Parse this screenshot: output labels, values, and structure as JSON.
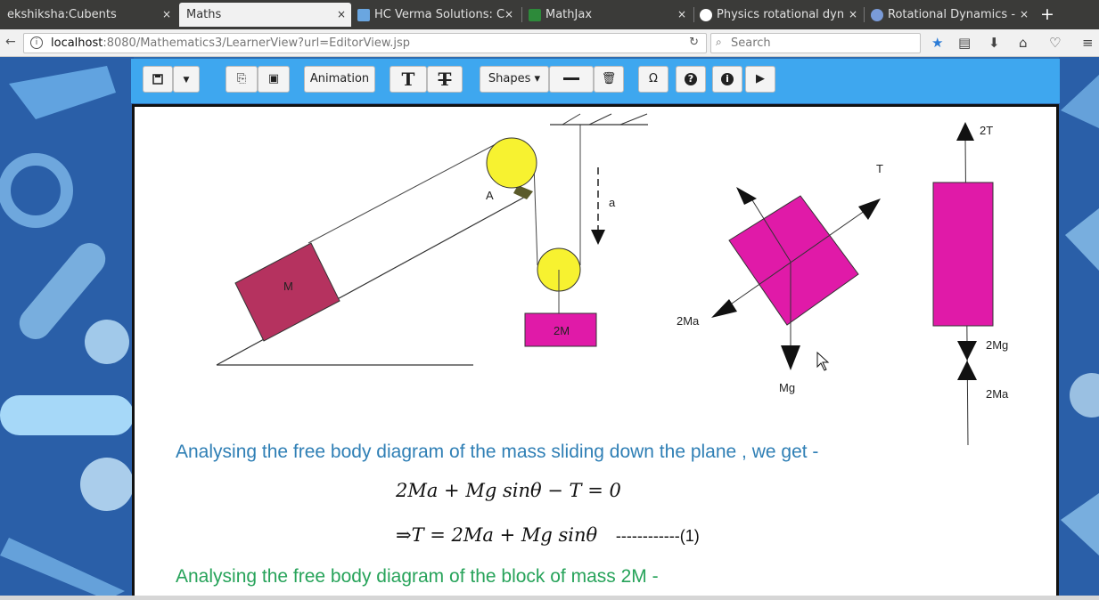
{
  "browser": {
    "tabs": [
      {
        "title": "ekshiksha:Cubents",
        "active": false,
        "favicon": "none"
      },
      {
        "title": "Maths",
        "active": true,
        "favicon": "none"
      },
      {
        "title": "HC Verma Solutions: C",
        "active": false,
        "favicon": "page-icon"
      },
      {
        "title": "MathJax",
        "active": false,
        "favicon": "mathjax-icon"
      },
      {
        "title": "Physics rotational dyn",
        "active": false,
        "favicon": "google-icon"
      },
      {
        "title": "Rotational Dynamics -",
        "active": false,
        "favicon": "globe-icon"
      }
    ],
    "close_glyph": "×",
    "new_tab_glyph": "+",
    "url_host": "localhost",
    "url_rest": ":8080/Mathematics3/LearnerView?url=EditorView.jsp",
    "search_placeholder": "Search"
  },
  "toolbar": {
    "animation_label": "Animation",
    "shapes_label": "Shapes ▾",
    "omega_label": "Ω",
    "text_bold_label": "T",
    "text_clear_label": "T"
  },
  "diagram": {
    "labels": {
      "pulley_point": "A",
      "accel": "a",
      "block_left": "M",
      "block_hanging": "2M",
      "tension": "T",
      "inertial_force": "2Ma",
      "weight": "Mg",
      "double_tension": "2T",
      "weight_2m": "2Mg",
      "inertial_2m": "2Ma"
    },
    "colors": {
      "block_m": "#b5325f",
      "block_2m": "#e01aa8",
      "pulley": "#f7f230",
      "pulley_bracket": "#5a5a2a"
    }
  },
  "content": {
    "paragraph1": "Analysing the free body diagram of the mass sliding down the plane , we get -",
    "equation1": "2Ma + Mg sinθ − T = 0",
    "equation2": "⇒T = 2Ma + Mg sinθ",
    "equation2_tag": "------------(1)",
    "paragraph2": "Analysing the free body diagram of the block of mass 2M -"
  }
}
